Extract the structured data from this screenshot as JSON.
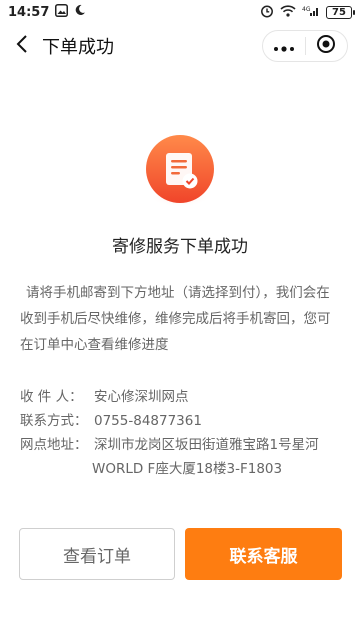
{
  "status_bar": {
    "time": "14:57",
    "battery": "75",
    "signal_label": "4G"
  },
  "nav": {
    "title": "下单成功"
  },
  "result": {
    "title": "寄修服务下单成功",
    "description": "请将手机邮寄到下方地址（请选择到付），我们会在收到手机后尽快维修，维修完成后将手机寄回，您可在订单中心查看维修进度"
  },
  "recipient_info": {
    "name_label": "收 件 人：",
    "name_value": "安心修深圳网点",
    "phone_label": "联系方式：",
    "phone_value": "0755-84877361",
    "address_label": "网点地址：",
    "address_line1": "深圳市龙岗区坂田街道雅宝路1号星河",
    "address_line2": "WORLD F座大厦18楼3-F1803"
  },
  "actions": {
    "view_orders": "查看订单",
    "contact_service": "联系客服"
  },
  "colors": {
    "accent": "#fe7d11",
    "icon_gradient_top": "#ff8a4a",
    "icon_gradient_bottom": "#f0452a"
  }
}
